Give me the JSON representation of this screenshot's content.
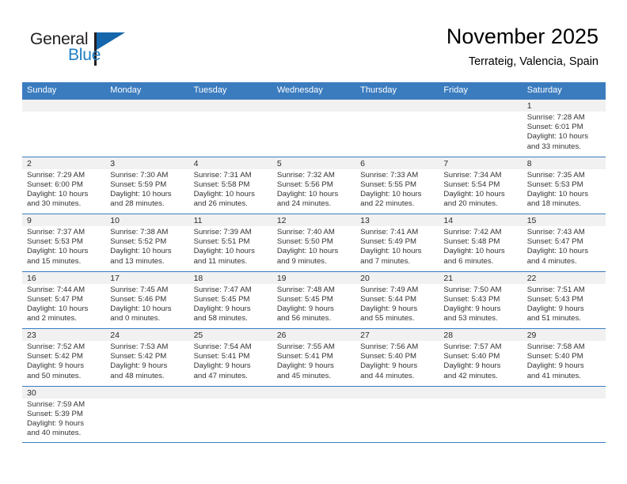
{
  "brand": {
    "word1": "General",
    "word2": "Blue",
    "logo_icon": "blue-triangle-icon",
    "accent_color": "#1566ab"
  },
  "header": {
    "month_title": "November 2025",
    "location": "Terrateig, Valencia, Spain"
  },
  "calendar": {
    "header_color": "#3b7cbf",
    "day_names": [
      "Sunday",
      "Monday",
      "Tuesday",
      "Wednesday",
      "Thursday",
      "Friday",
      "Saturday"
    ],
    "weeks": [
      [
        {
          "empty": true
        },
        {
          "empty": true
        },
        {
          "empty": true
        },
        {
          "empty": true
        },
        {
          "empty": true
        },
        {
          "empty": true
        },
        {
          "day": "1",
          "sunrise": "Sunrise: 7:28 AM",
          "sunset": "Sunset: 6:01 PM",
          "daylight1": "Daylight: 10 hours",
          "daylight2": "and 33 minutes."
        }
      ],
      [
        {
          "day": "2",
          "sunrise": "Sunrise: 7:29 AM",
          "sunset": "Sunset: 6:00 PM",
          "daylight1": "Daylight: 10 hours",
          "daylight2": "and 30 minutes."
        },
        {
          "day": "3",
          "sunrise": "Sunrise: 7:30 AM",
          "sunset": "Sunset: 5:59 PM",
          "daylight1": "Daylight: 10 hours",
          "daylight2": "and 28 minutes."
        },
        {
          "day": "4",
          "sunrise": "Sunrise: 7:31 AM",
          "sunset": "Sunset: 5:58 PM",
          "daylight1": "Daylight: 10 hours",
          "daylight2": "and 26 minutes."
        },
        {
          "day": "5",
          "sunrise": "Sunrise: 7:32 AM",
          "sunset": "Sunset: 5:56 PM",
          "daylight1": "Daylight: 10 hours",
          "daylight2": "and 24 minutes."
        },
        {
          "day": "6",
          "sunrise": "Sunrise: 7:33 AM",
          "sunset": "Sunset: 5:55 PM",
          "daylight1": "Daylight: 10 hours",
          "daylight2": "and 22 minutes."
        },
        {
          "day": "7",
          "sunrise": "Sunrise: 7:34 AM",
          "sunset": "Sunset: 5:54 PM",
          "daylight1": "Daylight: 10 hours",
          "daylight2": "and 20 minutes."
        },
        {
          "day": "8",
          "sunrise": "Sunrise: 7:35 AM",
          "sunset": "Sunset: 5:53 PM",
          "daylight1": "Daylight: 10 hours",
          "daylight2": "and 18 minutes."
        }
      ],
      [
        {
          "day": "9",
          "sunrise": "Sunrise: 7:37 AM",
          "sunset": "Sunset: 5:53 PM",
          "daylight1": "Daylight: 10 hours",
          "daylight2": "and 15 minutes."
        },
        {
          "day": "10",
          "sunrise": "Sunrise: 7:38 AM",
          "sunset": "Sunset: 5:52 PM",
          "daylight1": "Daylight: 10 hours",
          "daylight2": "and 13 minutes."
        },
        {
          "day": "11",
          "sunrise": "Sunrise: 7:39 AM",
          "sunset": "Sunset: 5:51 PM",
          "daylight1": "Daylight: 10 hours",
          "daylight2": "and 11 minutes."
        },
        {
          "day": "12",
          "sunrise": "Sunrise: 7:40 AM",
          "sunset": "Sunset: 5:50 PM",
          "daylight1": "Daylight: 10 hours",
          "daylight2": "and 9 minutes."
        },
        {
          "day": "13",
          "sunrise": "Sunrise: 7:41 AM",
          "sunset": "Sunset: 5:49 PM",
          "daylight1": "Daylight: 10 hours",
          "daylight2": "and 7 minutes."
        },
        {
          "day": "14",
          "sunrise": "Sunrise: 7:42 AM",
          "sunset": "Sunset: 5:48 PM",
          "daylight1": "Daylight: 10 hours",
          "daylight2": "and 6 minutes."
        },
        {
          "day": "15",
          "sunrise": "Sunrise: 7:43 AM",
          "sunset": "Sunset: 5:47 PM",
          "daylight1": "Daylight: 10 hours",
          "daylight2": "and 4 minutes."
        }
      ],
      [
        {
          "day": "16",
          "sunrise": "Sunrise: 7:44 AM",
          "sunset": "Sunset: 5:47 PM",
          "daylight1": "Daylight: 10 hours",
          "daylight2": "and 2 minutes."
        },
        {
          "day": "17",
          "sunrise": "Sunrise: 7:45 AM",
          "sunset": "Sunset: 5:46 PM",
          "daylight1": "Daylight: 10 hours",
          "daylight2": "and 0 minutes."
        },
        {
          "day": "18",
          "sunrise": "Sunrise: 7:47 AM",
          "sunset": "Sunset: 5:45 PM",
          "daylight1": "Daylight: 9 hours",
          "daylight2": "and 58 minutes."
        },
        {
          "day": "19",
          "sunrise": "Sunrise: 7:48 AM",
          "sunset": "Sunset: 5:45 PM",
          "daylight1": "Daylight: 9 hours",
          "daylight2": "and 56 minutes."
        },
        {
          "day": "20",
          "sunrise": "Sunrise: 7:49 AM",
          "sunset": "Sunset: 5:44 PM",
          "daylight1": "Daylight: 9 hours",
          "daylight2": "and 55 minutes."
        },
        {
          "day": "21",
          "sunrise": "Sunrise: 7:50 AM",
          "sunset": "Sunset: 5:43 PM",
          "daylight1": "Daylight: 9 hours",
          "daylight2": "and 53 minutes."
        },
        {
          "day": "22",
          "sunrise": "Sunrise: 7:51 AM",
          "sunset": "Sunset: 5:43 PM",
          "daylight1": "Daylight: 9 hours",
          "daylight2": "and 51 minutes."
        }
      ],
      [
        {
          "day": "23",
          "sunrise": "Sunrise: 7:52 AM",
          "sunset": "Sunset: 5:42 PM",
          "daylight1": "Daylight: 9 hours",
          "daylight2": "and 50 minutes."
        },
        {
          "day": "24",
          "sunrise": "Sunrise: 7:53 AM",
          "sunset": "Sunset: 5:42 PM",
          "daylight1": "Daylight: 9 hours",
          "daylight2": "and 48 minutes."
        },
        {
          "day": "25",
          "sunrise": "Sunrise: 7:54 AM",
          "sunset": "Sunset: 5:41 PM",
          "daylight1": "Daylight: 9 hours",
          "daylight2": "and 47 minutes."
        },
        {
          "day": "26",
          "sunrise": "Sunrise: 7:55 AM",
          "sunset": "Sunset: 5:41 PM",
          "daylight1": "Daylight: 9 hours",
          "daylight2": "and 45 minutes."
        },
        {
          "day": "27",
          "sunrise": "Sunrise: 7:56 AM",
          "sunset": "Sunset: 5:40 PM",
          "daylight1": "Daylight: 9 hours",
          "daylight2": "and 44 minutes."
        },
        {
          "day": "28",
          "sunrise": "Sunrise: 7:57 AM",
          "sunset": "Sunset: 5:40 PM",
          "daylight1": "Daylight: 9 hours",
          "daylight2": "and 42 minutes."
        },
        {
          "day": "29",
          "sunrise": "Sunrise: 7:58 AM",
          "sunset": "Sunset: 5:40 PM",
          "daylight1": "Daylight: 9 hours",
          "daylight2": "and 41 minutes."
        }
      ],
      [
        {
          "day": "30",
          "sunrise": "Sunrise: 7:59 AM",
          "sunset": "Sunset: 5:39 PM",
          "daylight1": "Daylight: 9 hours",
          "daylight2": "and 40 minutes."
        },
        {
          "empty": true
        },
        {
          "empty": true
        },
        {
          "empty": true
        },
        {
          "empty": true
        },
        {
          "empty": true
        },
        {
          "empty": true
        }
      ]
    ]
  }
}
